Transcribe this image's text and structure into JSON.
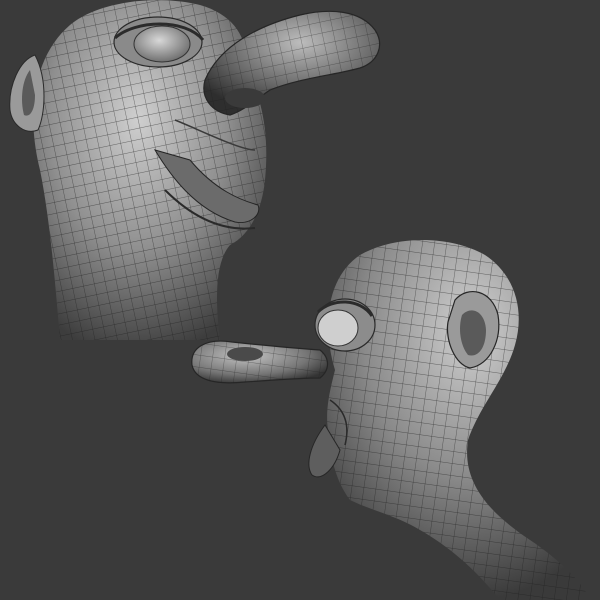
{
  "scene": {
    "background_color": "#3a3a3a",
    "mesh_base_color": "#8d8d8d",
    "mesh_highlight_color": "#c9c9c9",
    "mesh_shadow_color": "#3c3c3c",
    "wireframe_color": "#1e1e1e"
  },
  "views": [
    {
      "name": "front-three-quarter-view"
    },
    {
      "name": "side-profile-view"
    }
  ]
}
